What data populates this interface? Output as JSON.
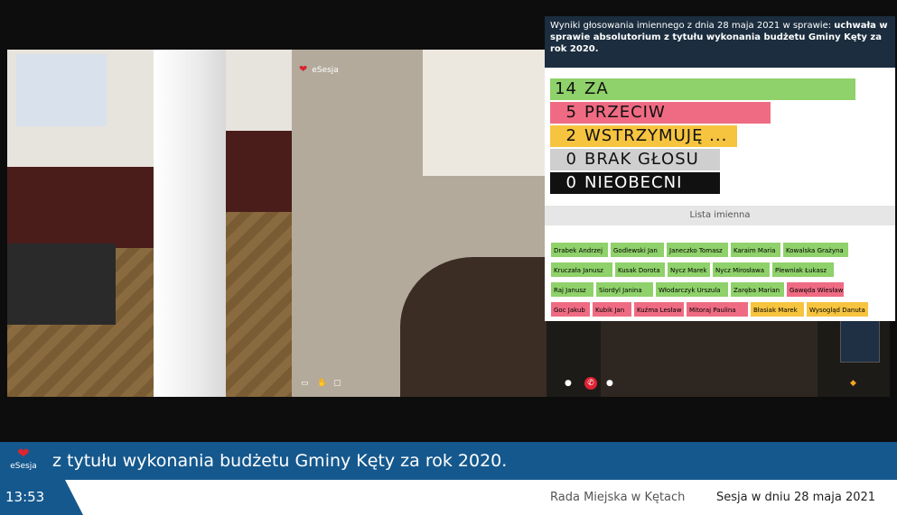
{
  "brand": {
    "name": "eSesja"
  },
  "vote": {
    "header_prefix": "Wyniki głosowania imiennego z dnia 28 maja 2021 w sprawie:",
    "header_subject": "uchwała w sprawie absolutorium z tytułu wykonania budżetu Gminy Kęty za rok 2020.",
    "results": [
      {
        "count": "14",
        "label": "ZA",
        "color": "#8fd16a",
        "fraction": 0.9
      },
      {
        "count": "5",
        "label": "PRZECIW",
        "color": "#ef6b83",
        "fraction": 0.65
      },
      {
        "count": "2",
        "label": "WSTRZYMUJĘ ...",
        "color": "#f6c43f",
        "fraction": 0.55
      },
      {
        "count": "0",
        "label": "BRAK GŁOSU",
        "color": "#cfcfcf",
        "fraction": 0.5
      },
      {
        "count": "0",
        "label": "NIEOBECNI",
        "color": "#111111",
        "fraction": 0.5
      }
    ],
    "list_title": "Lista imienna",
    "names": [
      [
        {
          "n": "Drabek Andrzej",
          "v": "za"
        },
        {
          "n": "Godlewski Jan",
          "v": "za"
        },
        {
          "n": "Janeczko Tomasz",
          "v": "za"
        },
        {
          "n": "Karaim Maria",
          "v": "za"
        },
        {
          "n": "Kowalska Grażyna",
          "v": "za"
        }
      ],
      [
        {
          "n": "Kruczała Janusz",
          "v": "za"
        },
        {
          "n": "Kusak Dorota",
          "v": "za"
        },
        {
          "n": "Nycz Marek",
          "v": "za"
        },
        {
          "n": "Nycz Mirosława",
          "v": "za"
        },
        {
          "n": "Plewniak Łukasz",
          "v": "za"
        }
      ],
      [
        {
          "n": "Raj Janusz",
          "v": "za"
        },
        {
          "n": "Siordyl Janina",
          "v": "za"
        },
        {
          "n": "Włodarczyk Urszula",
          "v": "za"
        },
        {
          "n": "Zaręba Marian",
          "v": "za"
        },
        {
          "n": "Gawęda Wiesław",
          "v": "przeciw"
        }
      ],
      [
        {
          "n": "Goc Jakub",
          "v": "przeciw"
        },
        {
          "n": "Kubik Jan",
          "v": "przeciw"
        },
        {
          "n": "Kuźma Lesław",
          "v": "przeciw"
        },
        {
          "n": "Mitoraj Paulina",
          "v": "przeciw"
        },
        {
          "n": "Błasiak Marek",
          "v": "wstrzymuje"
        },
        {
          "n": "Wysogląd Danuta",
          "v": "wstrzymuje"
        }
      ]
    ],
    "vote_colors": {
      "za": "#8fd16a",
      "przeciw": "#ef6b83",
      "wstrzymuje": "#f6c43f"
    }
  },
  "ticker": {
    "text": "z tytułu wykonania budżetu Gminy Kęty za rok 2020."
  },
  "footer": {
    "time": "13:53",
    "organization": "Rada Miejska w Kętach",
    "session": "Sesja w dniu 28 maja 2021"
  },
  "colors": {
    "accent": "#15588d",
    "header_bg": "#1b2d3e"
  }
}
